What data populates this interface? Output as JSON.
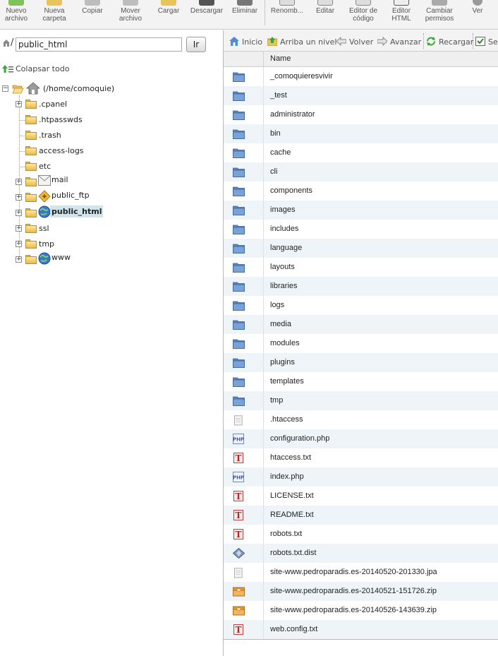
{
  "toolbar": {
    "buttons": [
      {
        "label": "Nuevo\narchivo",
        "icon": "new-file-icon"
      },
      {
        "label": "Nueva\ncarpeta",
        "icon": "new-folder-icon"
      },
      {
        "label": "Copiar",
        "icon": "copy-icon"
      },
      {
        "label": "Mover\narchivo",
        "icon": "move-icon"
      },
      {
        "label": "Cargar",
        "icon": "upload-icon"
      },
      {
        "label": "Descargar",
        "icon": "download-icon"
      },
      {
        "label": "Eliminar",
        "icon": "delete-icon"
      },
      {
        "label": "Renomb...",
        "icon": "rename-icon"
      },
      {
        "label": "Editar",
        "icon": "edit-icon"
      },
      {
        "label": "Editor de\ncódigo",
        "icon": "code-editor-icon"
      },
      {
        "label": "Editor\nHTML",
        "icon": "html-editor-icon"
      },
      {
        "label": "Cambiar\npermisos",
        "icon": "permissions-icon"
      },
      {
        "label": "Ver",
        "icon": "view-icon"
      }
    ]
  },
  "path_bar": {
    "slash": "/",
    "value": "public_html",
    "go_label": "Ir"
  },
  "tree": {
    "collapse_label": "Colapsar todo",
    "root_label": "(/home/comoquie)",
    "nodes": [
      {
        "label": ".cpanel"
      },
      {
        "label": ".htpasswds"
      },
      {
        "label": ".trash"
      },
      {
        "label": "access-logs"
      },
      {
        "label": "etc"
      },
      {
        "label": "mail"
      },
      {
        "label": "public_ftp"
      },
      {
        "label": "public_html"
      },
      {
        "label": "ssl"
      },
      {
        "label": "tmp"
      },
      {
        "label": "www"
      }
    ]
  },
  "nav": {
    "home": "Inicio",
    "up": "Arriba un nivel",
    "back": "Volver",
    "forward": "Avanzar",
    "reload": "Recargar",
    "select_all": "Se"
  },
  "list": {
    "header_name": "Name",
    "files": [
      {
        "name": "_comoquieresvivir",
        "type": "folder"
      },
      {
        "name": "_test",
        "type": "folder"
      },
      {
        "name": "administrator",
        "type": "folder"
      },
      {
        "name": "bin",
        "type": "folder"
      },
      {
        "name": "cache",
        "type": "folder"
      },
      {
        "name": "cli",
        "type": "folder"
      },
      {
        "name": "components",
        "type": "folder"
      },
      {
        "name": "images",
        "type": "folder"
      },
      {
        "name": "includes",
        "type": "folder"
      },
      {
        "name": "language",
        "type": "folder"
      },
      {
        "name": "layouts",
        "type": "folder"
      },
      {
        "name": "libraries",
        "type": "folder"
      },
      {
        "name": "logs",
        "type": "folder"
      },
      {
        "name": "media",
        "type": "folder"
      },
      {
        "name": "modules",
        "type": "folder"
      },
      {
        "name": "plugins",
        "type": "folder"
      },
      {
        "name": "templates",
        "type": "folder"
      },
      {
        "name": "tmp",
        "type": "folder"
      },
      {
        "name": ".htaccess",
        "type": "generic"
      },
      {
        "name": "configuration.php",
        "type": "php"
      },
      {
        "name": "htaccess.txt",
        "type": "text"
      },
      {
        "name": "index.php",
        "type": "php"
      },
      {
        "name": "LICENSE.txt",
        "type": "text"
      },
      {
        "name": "README.txt",
        "type": "text"
      },
      {
        "name": "robots.txt",
        "type": "text"
      },
      {
        "name": "robots.txt.dist",
        "type": "dist"
      },
      {
        "name": "site-www.pedroparadis.es-20140520-201330.jpa",
        "type": "generic"
      },
      {
        "name": "site-www.pedroparadis.es-20140521-151726.zip",
        "type": "archive"
      },
      {
        "name": "site-www.pedroparadis.es-20140526-143639.zip",
        "type": "archive"
      },
      {
        "name": "web.config.txt",
        "type": "text"
      }
    ]
  },
  "colors": {
    "folder_blue": "#5b86c0",
    "tree_folder": "#f0c85a",
    "selection": "#cfe4ec",
    "row_alt": "#eef4f8"
  }
}
